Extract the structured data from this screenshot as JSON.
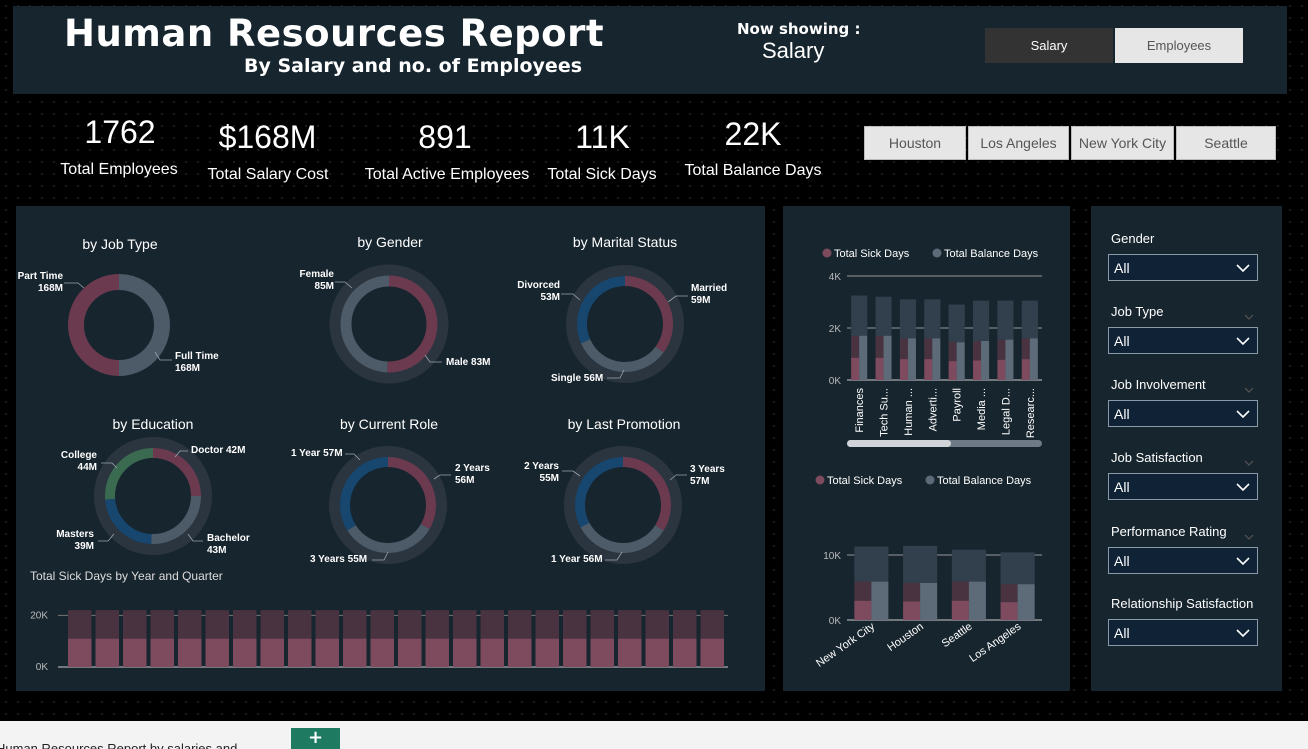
{
  "header": {
    "title": "Human Resources Report",
    "subtitle": "By Salary and no. of Employees",
    "now_showing_label": "Now showing :",
    "now_showing_value": "Salary",
    "toggle": [
      "Salary",
      "Employees"
    ]
  },
  "kpis": [
    {
      "value": "1762",
      "label": "Total Employees"
    },
    {
      "value": "$168M",
      "label": "Total Salary Cost"
    },
    {
      "value": "891",
      "label": "Total Active Employees"
    },
    {
      "value": "11K",
      "label": "Total Sick Days"
    },
    {
      "value": "22K",
      "label": "Total Balance Days"
    }
  ],
  "cities": [
    "Houston",
    "Los Angeles",
    "New York City",
    "Seattle"
  ],
  "colors": {
    "maroon": "#6b3a4e",
    "maroon_light": "#7d4a5e",
    "slate": "#4d5b69",
    "slate_light": "#5d6b79",
    "blue": "#17466e",
    "green": "#3a6a50",
    "panel": "#17252e"
  },
  "donuts": {
    "job_type": {
      "title": "by Job Type",
      "labels": [
        [
          "Part Time",
          "168M"
        ],
        [
          "Full Time",
          "168M"
        ]
      ]
    },
    "gender": {
      "title": "by Gender",
      "labels": [
        [
          "Female",
          "85M"
        ],
        [
          "Male 83M"
        ]
      ]
    },
    "marital": {
      "title": "by Marital Status",
      "labels": [
        [
          "Divorced",
          "53M"
        ],
        [
          "Married",
          "59M"
        ],
        [
          "Single 56M"
        ]
      ]
    },
    "education": {
      "title": "by Education",
      "labels": [
        [
          "College",
          "44M"
        ],
        [
          "Doctor 42M"
        ],
        [
          "Masters",
          "39M"
        ],
        [
          "Bachelor",
          "43M"
        ]
      ]
    },
    "role": {
      "title": "by Current Role",
      "labels": [
        [
          "1 Year 57M"
        ],
        [
          "2 Years",
          "56M"
        ],
        [
          "3 Years 55M"
        ]
      ]
    },
    "promotion": {
      "title": "by Last Promotion",
      "labels": [
        [
          "2 Years",
          "55M"
        ],
        [
          "3 Years",
          "57M"
        ],
        [
          "1 Year 56M"
        ]
      ]
    }
  },
  "chart_data": [
    {
      "type": "pie",
      "title": "by Job Type",
      "categories": [
        "Part Time",
        "Full Time"
      ],
      "values": [
        168,
        168
      ],
      "unit": "M"
    },
    {
      "type": "pie",
      "title": "by Gender",
      "categories": [
        "Female",
        "Male"
      ],
      "values": [
        85,
        83
      ],
      "unit": "M"
    },
    {
      "type": "pie",
      "title": "by Marital Status",
      "categories": [
        "Married",
        "Single",
        "Divorced"
      ],
      "values": [
        59,
        56,
        53
      ],
      "unit": "M"
    },
    {
      "type": "pie",
      "title": "by Education",
      "categories": [
        "Doctor",
        "Bachelor",
        "Masters",
        "College"
      ],
      "values": [
        42,
        43,
        39,
        44
      ],
      "unit": "M"
    },
    {
      "type": "pie",
      "title": "by Current Role",
      "categories": [
        "2 Years",
        "3 Years",
        "1 Year"
      ],
      "values": [
        56,
        55,
        57
      ],
      "unit": "M"
    },
    {
      "type": "pie",
      "title": "by Last Promotion",
      "categories": [
        "3 Years",
        "1 Year",
        "2 Years"
      ],
      "values": [
        57,
        56,
        55
      ],
      "unit": "M"
    },
    {
      "type": "bar",
      "title": "Total Sick Days by Year and Quarter",
      "stacked": true,
      "categories": [
        "",
        "",
        "",
        "",
        "",
        "",
        "",
        "",
        "",
        "",
        "",
        "",
        "",
        "",
        "",
        "",
        "",
        "",
        "",
        "",
        "",
        "",
        "",
        ""
      ],
      "series": [
        {
          "values": [
            11000,
            11000,
            11000,
            11000,
            11000,
            11000,
            11000,
            11000,
            11000,
            11000,
            11000,
            11000,
            11000,
            11000,
            11000,
            11000,
            11000,
            11000,
            11000,
            11000,
            11000,
            11000,
            11000,
            11000
          ]
        },
        {
          "values": [
            11000,
            11000,
            11000,
            11000,
            11000,
            11000,
            11000,
            11000,
            11000,
            11000,
            11000,
            11000,
            11000,
            11000,
            11000,
            11000,
            11000,
            11000,
            11000,
            11000,
            11000,
            11000,
            11000,
            11000
          ]
        }
      ],
      "yticks": [
        "0K",
        "20K"
      ],
      "ylim": [
        0,
        24000
      ]
    },
    {
      "type": "bar",
      "title": "",
      "legend": [
        "Total Sick Days",
        "Total Balance Days"
      ],
      "categories": [
        "Finances",
        "Tech Su...",
        "Human ...",
        "Adverti...",
        "Payroll",
        "Media ...",
        "Legal D...",
        "Researc..."
      ],
      "series": [
        {
          "name": "Total Sick Days",
          "values": [
            1700,
            1700,
            1600,
            1600,
            1450,
            1500,
            1550,
            1600
          ]
        },
        {
          "name": "Total Balance Days",
          "values": [
            3250,
            3200,
            3100,
            3100,
            2900,
            3050,
            3050,
            3050
          ]
        }
      ],
      "yticks": [
        "0K",
        "2K",
        "4K"
      ],
      "ylim": [
        0,
        4000
      ]
    },
    {
      "type": "bar",
      "title": "",
      "legend": [
        "Total Sick Days",
        "Total Balance Days"
      ],
      "categories": [
        "New York City",
        "Houston",
        "Seattle",
        "Los Angeles"
      ],
      "series": [
        {
          "name": "Total Sick Days",
          "values": [
            5900,
            5700,
            5900,
            5500
          ]
        },
        {
          "name": "Total Balance Days",
          "values": [
            11300,
            11400,
            10800,
            10400
          ]
        }
      ],
      "yticks": [
        "0K",
        "10K"
      ],
      "ylim": [
        0,
        12000
      ]
    }
  ],
  "filters": [
    {
      "label": "Gender",
      "value": "All"
    },
    {
      "label": "Job Type",
      "value": "All"
    },
    {
      "label": "Job Involvement",
      "value": "All"
    },
    {
      "label": "Job Satisfaction",
      "value": "All"
    },
    {
      "label": "Performance Rating",
      "value": "All"
    },
    {
      "label": "Relationship Satisfaction",
      "value": "All"
    }
  ],
  "footer": {
    "tab_label": "Human Resources Report by salaries and ...",
    "add_label": "+"
  }
}
